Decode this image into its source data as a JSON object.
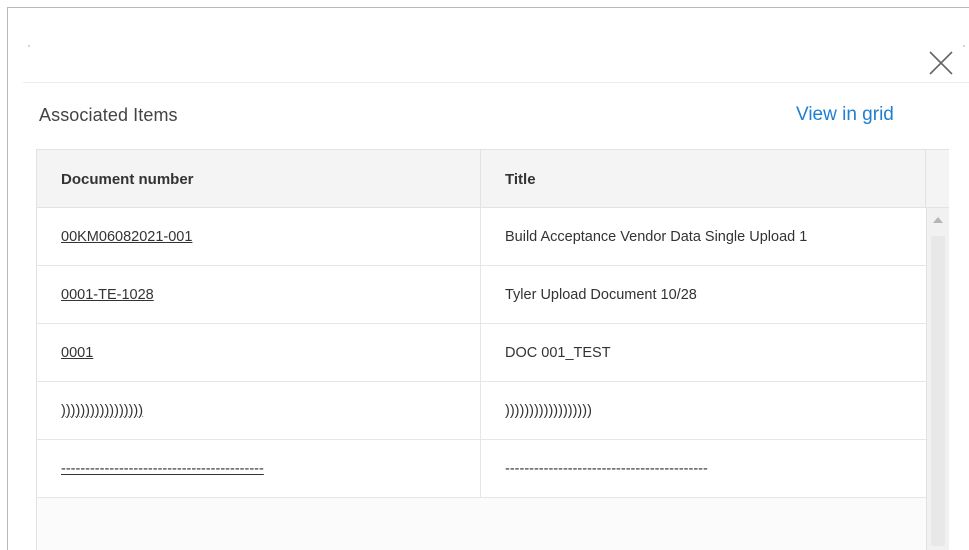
{
  "dialog": {
    "section_title": "Associated Items",
    "view_in_grid_label": "View in grid",
    "close_icon": "close-x-icon"
  },
  "grid": {
    "columns": [
      "Document number",
      "Title"
    ],
    "rows": [
      {
        "number": "00KM06082021-001",
        "title": "Build Acceptance Vendor Data Single Upload 1"
      },
      {
        "number": "0001-TE-1028",
        "title": "Tyler Upload Document 10/28"
      },
      {
        "number": "0001",
        "title": "DOC 001_TEST"
      },
      {
        "number": ")))))))))))))))))",
        "title": "))))))))))))))))))"
      },
      {
        "number": "------------------------------------------",
        "title": "------------------------------------------"
      }
    ]
  },
  "colors": {
    "link": "#1f7fd1",
    "header_bg": "#f4f4f4",
    "border": "#e2e2e2"
  }
}
